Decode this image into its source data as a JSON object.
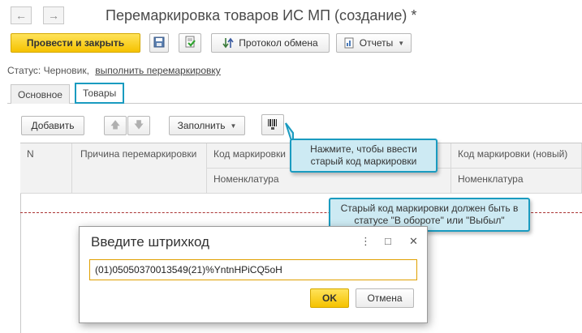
{
  "window": {
    "title": "Перемаркировка товаров ИС МП (создание) *",
    "back_glyph": "←",
    "forward_glyph": "→"
  },
  "toolbar": {
    "post_close_label": "Провести и закрыть",
    "exchange_protocol_label": "Протокол обмена",
    "reports_label": "Отчеты"
  },
  "status": {
    "label": "Статус:",
    "value": "Черновик,",
    "link": "выполнить перемаркировку"
  },
  "tabs": [
    {
      "label": "Основное",
      "active": false
    },
    {
      "label": "Товары",
      "active": true
    }
  ],
  "goods_toolbar": {
    "add_label": "Добавить",
    "fill_label": "Заполнить"
  },
  "table": {
    "columns": {
      "n": "N",
      "reason": "Причина перемаркировки",
      "code_old": "Код маркировки",
      "nomenclature_1": "Номенклатура",
      "code_new": "Код маркировки (новый)",
      "nomenclature_2": "Номенклатура"
    }
  },
  "callouts": {
    "scan_hint": "Нажмите, чтобы ввести старый код маркировки",
    "status_hint": "Старый код маркировки должен быть в статусе \"В обороте\" или \"Выбыл\""
  },
  "dialog": {
    "title": "Введите штрихкод",
    "barcode_value": "(01)05050370013549(21)%YntnHPiCQ5oH",
    "ok_label": "OK",
    "cancel_label": "Отмена"
  },
  "colors": {
    "accent": "#1a9bc0",
    "primary_button": "#f5c200",
    "callout_bg": "#cdeaf3"
  }
}
